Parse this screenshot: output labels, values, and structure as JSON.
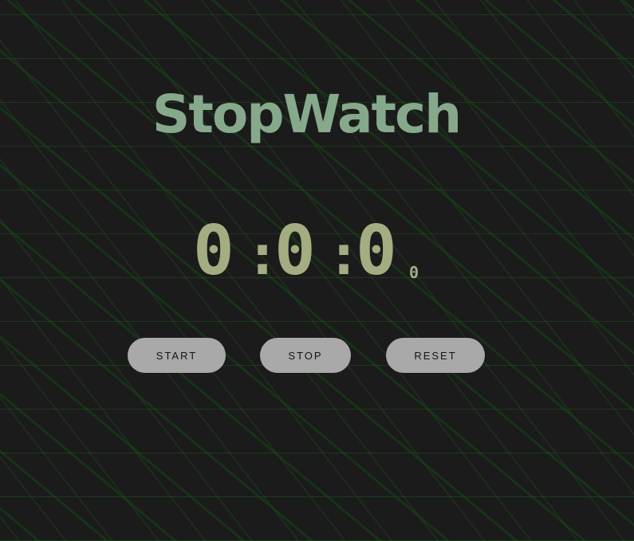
{
  "app": {
    "title": "StopWatch"
  },
  "display": {
    "hours": "0",
    "minutes": "0",
    "seconds": "0",
    "separator": ":",
    "milliseconds": "0"
  },
  "buttons": {
    "start_label": "START",
    "stop_label": "STOP",
    "reset_label": "RESET"
  },
  "colors": {
    "background": "#1b1b1b",
    "pattern_green": "#1e5a1e",
    "title": "#86a98b",
    "digits": "#a4ac82",
    "button_bg": "#a9a9a9",
    "button_text": "#141414"
  }
}
